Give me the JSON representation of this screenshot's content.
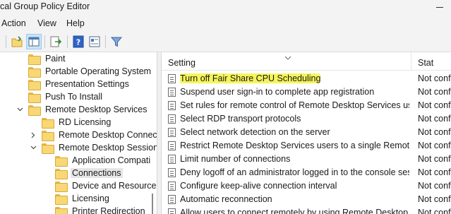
{
  "window": {
    "title": "cal Group Policy Editor"
  },
  "menu": {
    "action": "Action",
    "view": "View",
    "help": "Help"
  },
  "toolbar": {
    "icons": [
      "open-folder-icon",
      "show-hide-tree-icon",
      "export-list-icon",
      "help-icon",
      "properties-icon",
      "filter-icon"
    ],
    "pressed": "show-hide-tree-icon"
  },
  "tree": {
    "items": [
      {
        "label": "Paint",
        "level": 0
      },
      {
        "label": "Portable Operating System",
        "level": 0
      },
      {
        "label": "Presentation Settings",
        "level": 0
      },
      {
        "label": "Push To Install",
        "level": 0
      },
      {
        "label": "Remote Desktop Services",
        "level": 0,
        "expanded": true
      },
      {
        "label": "RD Licensing",
        "level": 1
      },
      {
        "label": "Remote Desktop Connec",
        "level": 1,
        "expandable": true
      },
      {
        "label": "Remote Desktop Session",
        "level": 1,
        "expanded": true
      },
      {
        "label": "Application Compati",
        "level": 2
      },
      {
        "label": "Connections",
        "level": 2,
        "selected": true
      },
      {
        "label": "Device and Resource",
        "level": 2
      },
      {
        "label": "Licensing",
        "level": 2
      },
      {
        "label": "Printer Redirection",
        "level": 2
      }
    ]
  },
  "list": {
    "columns": {
      "setting": "Setting",
      "state": "Stat"
    },
    "rows": [
      {
        "name": "Turn off Fair Share CPU Scheduling",
        "state": "Not conf",
        "highlighted": true
      },
      {
        "name": "Suspend user sign-in to complete app registration",
        "state": "Not conf"
      },
      {
        "name": "Set rules for remote control of Remote Desktop Services use...",
        "state": "Not conf"
      },
      {
        "name": "Select RDP transport protocols",
        "state": "Not conf"
      },
      {
        "name": "Select network detection on the server",
        "state": "Not conf"
      },
      {
        "name": "Restrict Remote Desktop Services users to a single Remote D...",
        "state": "Not conf"
      },
      {
        "name": "Limit number of connections",
        "state": "Not conf"
      },
      {
        "name": "Deny logoff of an administrator logged in to the console ses...",
        "state": "Not conf"
      },
      {
        "name": "Configure keep-alive connection interval",
        "state": "Not conf"
      },
      {
        "name": "Automatic reconnection",
        "state": "Not conf"
      },
      {
        "name": "Allow users to connect remotely by using Remote Desktop S...",
        "state": "Not conf"
      }
    ]
  },
  "colors": {
    "highlight": "#f5f55a",
    "selected_row": "#e5e5e5",
    "folder": "#f8d775",
    "pressed_button": "#cce4f7"
  }
}
